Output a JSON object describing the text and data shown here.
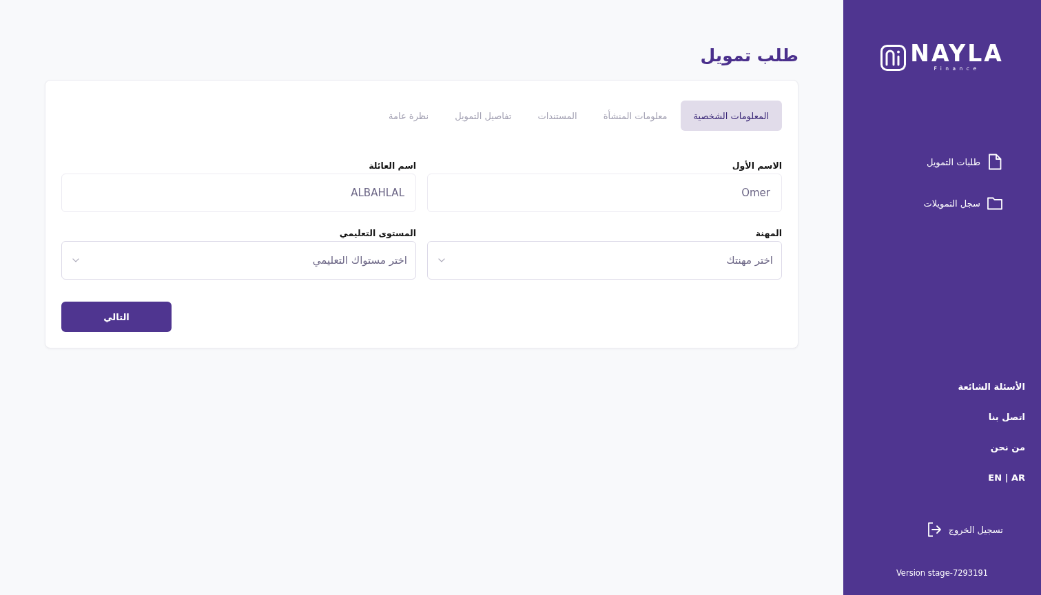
{
  "page_title": "طلب تمويل",
  "tabs": [
    {
      "label": "المعلومات الشخصية",
      "selected": true
    },
    {
      "label": "معلومات المنشأة",
      "selected": false
    },
    {
      "label": "المستندات",
      "selected": false
    },
    {
      "label": "تفاصيل التمويل",
      "selected": false
    },
    {
      "label": "نظرة عامة",
      "selected": false
    }
  ],
  "form": {
    "fields": [
      {
        "kind": "text",
        "label": "الاسم الأول",
        "value": "Omer"
      },
      {
        "kind": "text",
        "label": "اسم العائلة",
        "value": "ALBAHLAL"
      },
      {
        "kind": "select",
        "label": "المهنة",
        "placeholder": "اختر مهنتك"
      },
      {
        "kind": "select",
        "label": "المستوى التعليمي",
        "placeholder": "اختر مستواك التعليمي"
      }
    ],
    "next_button": "التالي"
  },
  "sidebar": {
    "logo": {
      "name": "NAYLA",
      "tagline": "Finance"
    },
    "nav_items": [
      {
        "kind": "requests",
        "label": "طلبات التمويل"
      },
      {
        "kind": "history",
        "label": "سجل التمويلات"
      }
    ],
    "links": [
      "الأسئلة الشائعة",
      "اتصل بنا",
      "من نحن"
    ],
    "language_link": "EN | AR",
    "logout": "تسجيل الخروج",
    "version": "Version stage-7293191"
  }
}
